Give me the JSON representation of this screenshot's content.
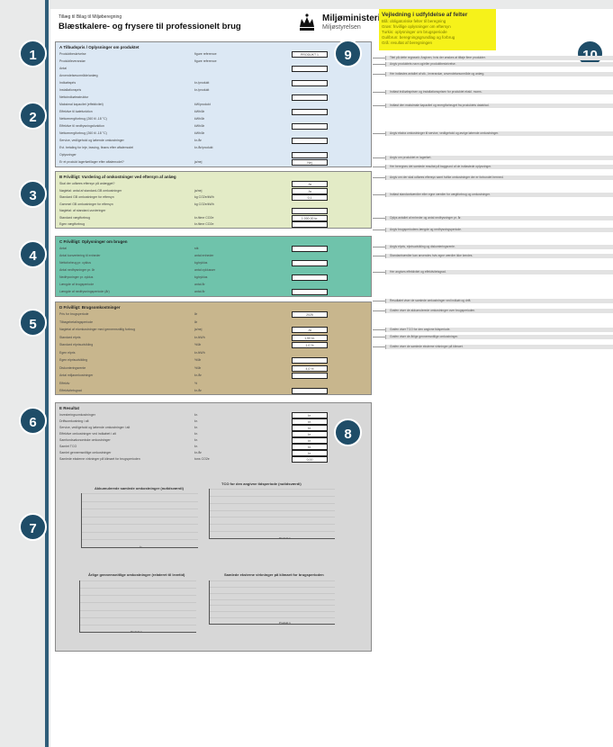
{
  "header": {
    "kicker": "Tillæg til Bilag til Miljøberegning",
    "title": "Blæstkalere- og frysere til professionelt brug",
    "ministry": "Miljøministeriet",
    "agency": "Miljøstyrelsen"
  },
  "guide": {
    "title": "Vejledning i udfyldelse af felter",
    "lines": [
      "Blå: obligatoriske felter til beregning",
      "Grøn: frivillige oplysninger om eftersyn",
      "Turkis: oplysninger om brugsperiode",
      "Gul/brun: beregningsgrundlag og forbrug",
      "Grå: resultat af beregningen"
    ]
  },
  "badges": [
    "1",
    "2",
    "3",
    "4",
    "5",
    "6",
    "7",
    "8",
    "9",
    "10"
  ],
  "sections": {
    "s1": {
      "title": "A  Tilbudspris / Oplysninger om produktet",
      "rows": [
        {
          "label": "Produktbeskrivelse",
          "unit": "figure reference",
          "value": "PRODUKT 1"
        },
        {
          "label": "Produktleverandør",
          "unit": "figure reference",
          "value": ""
        },
        {
          "label": "Antal",
          "unit": "",
          "value": ""
        },
        {
          "label": "Anvendelsesområde/anlæg",
          "unit": "",
          "value": ""
        },
        {
          "label": "Indkøbspris",
          "unit": "kr./produkt",
          "value": ""
        },
        {
          "label": "Installationspris",
          "unit": "kr./produkt",
          "value": ""
        },
        {
          "label": "Nettoindkøbsstruktur",
          "unit": "",
          "value": ""
        },
        {
          "label": "Maksimal kapacitet (effektivitet)",
          "unit": "kW/produkt",
          "value": ""
        },
        {
          "label": "Effektive til kølefunktion",
          "unit": "kWh/år",
          "value": ""
        },
        {
          "label": "Nettoenergiforbrug (260 til -18 °C)",
          "unit": "kWh/år",
          "value": ""
        },
        {
          "label": "Effektive til nedfrysningsfunktion",
          "unit": "kWh/år",
          "value": ""
        },
        {
          "label": "Nettoenergiforbrug (260 til -18 °C)",
          "unit": "kWh/år",
          "value": ""
        },
        {
          "label": "Service, vedligehold og løbende omkostninger",
          "unit": "kr./år",
          "value": ""
        },
        {
          "label": "Evt. betaling for leje, leasing, finans efter aftalemodel",
          "unit": "kr./år/produkt",
          "value": ""
        },
        {
          "label": "Oplysninger",
          "unit": "",
          "value": ""
        },
        {
          "label": "Er et produkt lagerført/lager efter aftalemodel?",
          "unit": "ja/nej",
          "value": "Nej"
        }
      ]
    },
    "s2": {
      "title": "B  Frivilligt: Vurdering af omkostninger ved eftersyn af anlæg",
      "rows": [
        {
          "label": "Skal der udføres eftersyn på anlægget?",
          "unit": "",
          "value": "Ja"
        },
        {
          "label": "Nøgletal: antal af standard-GB omkostninger",
          "unit": "ja/nej",
          "value": "Ja"
        },
        {
          "label": "Standard GB omkostninger for eftersyn",
          "unit": "kg CO2e/kWh",
          "value": "0,1"
        },
        {
          "label": "Gammel GB omkostninger for eftersyn",
          "unit": "kg CO2e/kWh",
          "value": ""
        },
        {
          "label": "Nøgletal: af standard-vurderinger",
          "unit": "",
          "value": ""
        },
        {
          "label": "Standard vægtforbrug",
          "unit": "kr./time CO2e",
          "value": "1.000,00 kr."
        },
        {
          "label": "Egen vægtforbrug",
          "unit": "kr./time CO2e",
          "value": ""
        }
      ]
    },
    "s3": {
      "title": "C  Frivilligt: Oplysninger om brugen",
      "rows": [
        {
          "label": "Antal",
          "unit": "stk",
          "value": ""
        },
        {
          "label": "Antal konvertering til enheder",
          "unit": "antal enheder",
          "value": ""
        },
        {
          "label": "Nettoforbrug pr. cyklus",
          "unit": "kg/cyklus",
          "value": ""
        },
        {
          "label": "Antal nedfrysninger pr. år",
          "unit": "antal cyklusser",
          "value": ""
        },
        {
          "label": "Nedfrysninger pr. cyklus",
          "unit": "kg/cyklus",
          "value": ""
        },
        {
          "label": "Længde af brugsperiode",
          "unit": "antal år",
          "value": ""
        },
        {
          "label": "Længde af nedfrysningsperiode (år)",
          "unit": "antal år",
          "value": ""
        }
      ]
    },
    "s4": {
      "title": "D  Frivilligt: Brugsomkostninger",
      "rows": [
        {
          "label": "Pris for brugsperiode",
          "unit": "år",
          "value": "2025"
        },
        {
          "label": "Tilbagebetalingsperiode",
          "unit": "år",
          "value": ""
        },
        {
          "label": "Nøgletal af elomkostninger med gennemsnitlig forbrug",
          "unit": "ja/nej",
          "value": "Ja"
        },
        {
          "label": "Standard elpris",
          "unit": "kr./kWh",
          "value": "1,50 kr."
        },
        {
          "label": "Standard elprisudvikling",
          "unit": "%/år",
          "value": "1,0 %"
        },
        {
          "label": "Egen elpris",
          "unit": "kr./kWh",
          "value": ""
        },
        {
          "label": "Egen elprisudvikling",
          "unit": "%/år",
          "value": ""
        },
        {
          "label": "Diskonteringsrente",
          "unit": "%/år",
          "value": "4,0 %"
        },
        {
          "label": "Antal miljøomkostninger",
          "unit": "kr./år",
          "value": ""
        },
        {
          "label": "Effektiv",
          "unit": "%",
          "value": ""
        },
        {
          "label": "Effektivitetsgrad",
          "unit": "kr./år",
          "value": ""
        }
      ]
    },
    "s5": {
      "title": "E  Resultat",
      "rows": [
        {
          "label": "Investeringsomkostninger",
          "unit": "kr.",
          "value": "kr."
        },
        {
          "label": "Driftsomkostning i alt",
          "unit": "kr.",
          "value": "kr."
        },
        {
          "label": "Service, vedligehold og løbende omkostninger i alt",
          "unit": "kr.",
          "value": "kr."
        },
        {
          "label": "Effektive omkostninger ved indkøbet i alt",
          "unit": "kr.",
          "value": "kr."
        },
        {
          "label": "Samfundsøkonomiske omkostninger",
          "unit": "kr.",
          "value": "kr."
        },
        {
          "label": "Samlet TCO",
          "unit": "kr.",
          "value": "kr."
        },
        {
          "label": "Samlet gennemsnitlige omkostninger",
          "unit": "kr./år",
          "value": "kr."
        },
        {
          "label": "Samlede eksterne virkninger på klimaet for brugsperioden",
          "unit": "tons CO2e",
          "value": "0,00"
        }
      ]
    }
  },
  "charts": {
    "c1": {
      "title": "Akkumulerede samlede omkostninger (nutidsværdi)",
      "xlabel": "år"
    },
    "c2": {
      "title": "TCO for den angivne tidsperiode (nutidsværdi)",
      "xlabel": "Produkt 1"
    },
    "c3": {
      "title": "Årlige gennemsnitlige omkostninger (relateret til levetid)",
      "xlabel": "Produkt 1"
    },
    "c4": {
      "title": "Samlede eksterne virkninger på klimaet for brugsperioden",
      "xlabel": "Produkt 1"
    }
  },
  "notes": [
    "Titel på dette regneark: Angiven, hvis der ønskes at tilføje flere produkter.",
    "Angiv produktets navn og/eller produktbeskrivelse.",
    "Her indtastes antallet af stk., leverandør, anvendelsesområde og anlæg.",
    "Indtast indkøbsprisen og installationsprisen for produktet ekskl. moms.",
    "Indtast den maksimale kapacitet og energiforbruget fra produktets datablad.",
    "Angiv ekstra omkostninger til service, vedligehold og øvrige løbende omkostninger.",
    "Angiv om produktet er lagerført.",
    "Her beregnes det samlede resultat på baggrund af de indtastede oplysninger.",
    "Angiv om der skal udføres eftersyn samt hvilke omkostninger der er forbundet hermed.",
    "Indtast standardværdier eller egne værdier for vægtforbrug og omkostninger.",
    "Oplys antallet af enheder og antal nedfrysninger pr. år.",
    "Angiv brugsperiodens længde og nedfrysningsperiode.",
    "Angiv elpris, elprisudvikling og diskonteringsrente.",
    "Standardværdier kan anvendes hvis egne værdier ikke kendes.",
    "Her angives effektivitet og effektivitetsgrad.",
    "Resultatet viser de samlede omkostninger ved indkøb og drift.",
    "Grafen viser de akkumulerede omkostninger over brugsperioden.",
    "Grafen viser TCO for den angivne tidsperiode.",
    "Grafen viser de årlige gennemsnitlige omkostninger.",
    "Grafen viser de samlede eksterne virkninger på klimaet."
  ]
}
